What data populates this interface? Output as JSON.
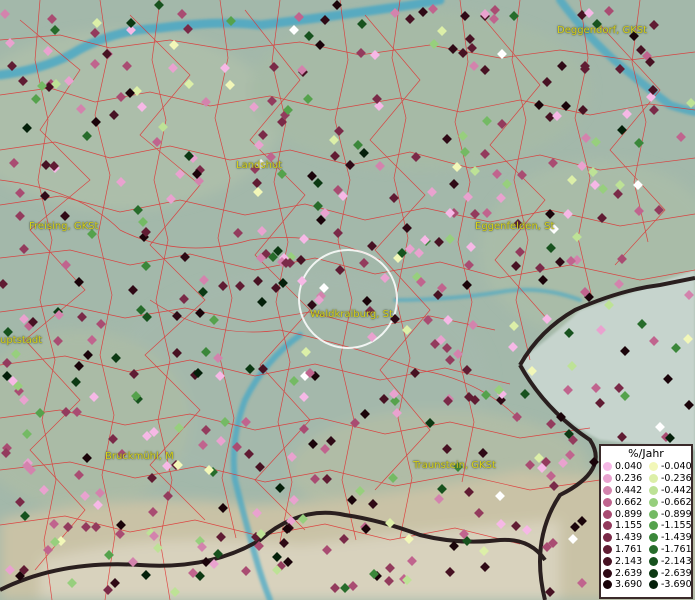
{
  "map": {
    "cities": [
      {
        "name": "Deggendorf, GKSt"
      },
      {
        "name": "Landshut"
      },
      {
        "name": "Freising, GKSt"
      },
      {
        "name": "Eggenfelden, St"
      },
      {
        "name": "Waldkraiburg, St"
      },
      {
        "name": "uptstadt"
      },
      {
        "name": "Bruckmühl, M"
      },
      {
        "name": "Traunstein, GKSt"
      }
    ],
    "colors": {
      "boundary": "#e03030",
      "river": "#3fa6c8",
      "border": "#2a1f1f",
      "label": "#d7d21a"
    }
  },
  "legend": {
    "title": "%/Jahr",
    "positive": [
      {
        "value": "0.040",
        "color": "#f6b8e6"
      },
      {
        "value": "0.236",
        "color": "#e9a2cf"
      },
      {
        "value": "0.442",
        "color": "#d383ad"
      },
      {
        "value": "0.662",
        "color": "#c0648e"
      },
      {
        "value": "0.899",
        "color": "#a94c72"
      },
      {
        "value": "1.155",
        "color": "#933b5d"
      },
      {
        "value": "1.439",
        "color": "#7a2a48"
      },
      {
        "value": "1.761",
        "color": "#601c33"
      },
      {
        "value": "2.143",
        "color": "#471223"
      },
      {
        "value": "2.639",
        "color": "#2f0a16"
      },
      {
        "value": "3.690",
        "color": "#1a040a"
      }
    ],
    "negative": [
      {
        "value": "-0.040",
        "color": "#f2f7b8"
      },
      {
        "value": "-0.236",
        "color": "#dcefa8"
      },
      {
        "value": "-0.442",
        "color": "#bde296"
      },
      {
        "value": "-0.662",
        "color": "#97cf7d"
      },
      {
        "value": "-0.899",
        "color": "#74ba64"
      },
      {
        "value": "-1.155",
        "color": "#55a24c"
      },
      {
        "value": "-1.439",
        "color": "#3b873a"
      },
      {
        "value": "-1.761",
        "color": "#276c2b"
      },
      {
        "value": "-2.143",
        "color": "#17521e"
      },
      {
        "value": "-2.639",
        "color": "#0c3913"
      },
      {
        "value": "-3.690",
        "color": "#04200a"
      }
    ]
  }
}
